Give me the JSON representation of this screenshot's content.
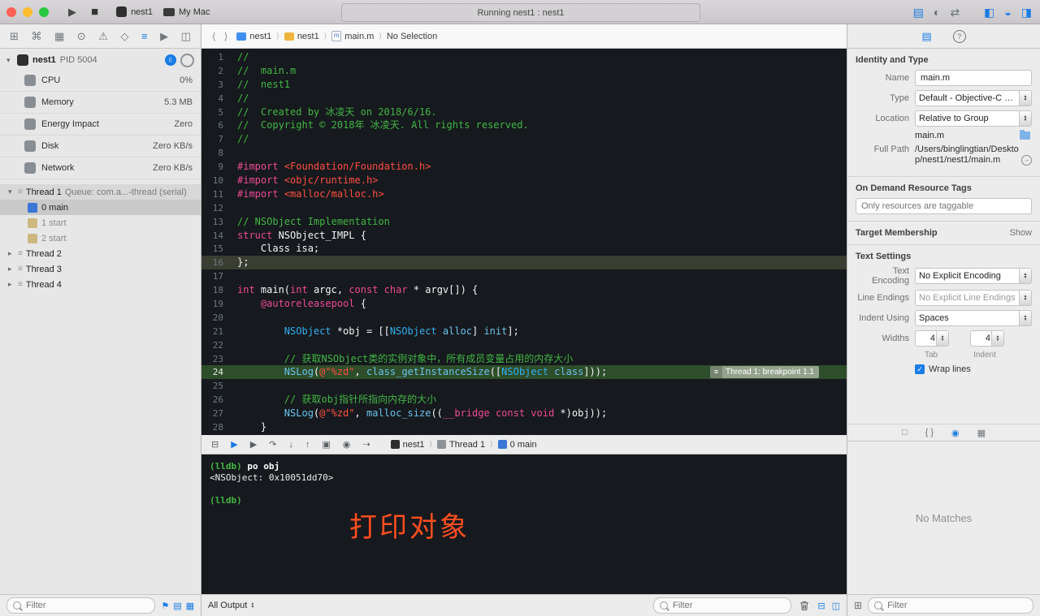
{
  "colors": {
    "accent": "#1a7ce5",
    "editor_background": "#16191d",
    "comment_green": "#41b645",
    "keyword_pink": "#ed4a96",
    "string_red": "#ff4f43",
    "type_blue": "#30b0f4",
    "function_blue": "#69c3f0",
    "exec_line_green": "#2e4d2a",
    "breakpoint_badge_green": "#93a28c",
    "annotation_orange": "#ff4e1f"
  },
  "window": {
    "run_glyph": "▶",
    "stop_glyph": "■",
    "scheme": "nest1",
    "destination": "My Mac",
    "status": "Running nest1 : nest1",
    "editor_mode_icons": [
      {
        "name": "standard-editor-icon",
        "glyph": "▤",
        "active": true
      },
      {
        "name": "assistant-editor-icon",
        "glyph": "◐",
        "active": false
      },
      {
        "name": "version-editor-icon",
        "glyph": "⇄",
        "active": false
      }
    ],
    "panel_toggle_icons": [
      {
        "name": "navigator-panel-icon",
        "glyph": "◧"
      },
      {
        "name": "debug-area-icon",
        "glyph": "◒"
      },
      {
        "name": "inspector-panel-icon",
        "glyph": "◨"
      }
    ]
  },
  "navigator_bar": {
    "icons": [
      {
        "name": "project-navigator-icon",
        "glyph": "⊞",
        "active": false
      },
      {
        "name": "source-control-navigator-icon",
        "glyph": "⌘",
        "active": false
      },
      {
        "name": "symbol-navigator-icon",
        "glyph": "▦",
        "active": false
      },
      {
        "name": "find-navigator-icon",
        "glyph": "⊙",
        "active": false
      },
      {
        "name": "issue-navigator-icon",
        "glyph": "⚠",
        "active": false
      },
      {
        "name": "test-navigator-icon",
        "glyph": "◇",
        "active": false
      },
      {
        "name": "debug-navigator-icon",
        "glyph": "≡",
        "active": true
      },
      {
        "name": "breakpoint-navigator-icon",
        "glyph": "▶",
        "active": false
      },
      {
        "name": "report-navigator-icon",
        "glyph": "◫",
        "active": false
      }
    ]
  },
  "jump_bar": {
    "items": [
      "nest1",
      "nest1",
      "main.m",
      "No Selection"
    ]
  },
  "debug_navigator": {
    "process": {
      "name": "nest1",
      "pid": "PID 5004"
    },
    "gauges": [
      {
        "label": "CPU",
        "value": "0%",
        "icon": "cpu-gauge-icon"
      },
      {
        "label": "Memory",
        "value": "5.3 MB",
        "icon": "memory-gauge-icon"
      },
      {
        "label": "Energy Impact",
        "value": "Zero",
        "icon": "energy-gauge-icon"
      },
      {
        "label": "Disk",
        "value": "Zero KB/s",
        "icon": "disk-gauge-icon"
      },
      {
        "label": "Network",
        "value": "Zero KB/s",
        "icon": "network-gauge-icon"
      }
    ],
    "threads": [
      {
        "label": "Thread 1",
        "queue": "Queue: com.a...-thread (serial)",
        "expanded": true,
        "selected": true,
        "frames": [
          {
            "label": "0 main",
            "color": "#3b76d8",
            "selected": true
          },
          {
            "label": "1 start",
            "color": "#cdb87f",
            "dim": true
          },
          {
            "label": "2 start",
            "color": "#cdb87f",
            "dim": true
          }
        ]
      },
      {
        "label": "Thread 2",
        "expanded": false,
        "frames": []
      },
      {
        "label": "Thread 3",
        "expanded": false,
        "frames": []
      },
      {
        "label": "Thread 4",
        "expanded": false,
        "frames": []
      }
    ]
  },
  "editor": {
    "lines": [
      {
        "n": 1,
        "seg": [
          [
            "c",
            "//"
          ]
        ]
      },
      {
        "n": 2,
        "seg": [
          [
            "c",
            "//  main.m"
          ]
        ]
      },
      {
        "n": 3,
        "seg": [
          [
            "c",
            "//  nest1"
          ]
        ]
      },
      {
        "n": 4,
        "seg": [
          [
            "c",
            "//"
          ]
        ]
      },
      {
        "n": 5,
        "seg": [
          [
            "c",
            "//  Created by 冰凌天 on 2018/6/16."
          ]
        ]
      },
      {
        "n": 6,
        "seg": [
          [
            "c",
            "//  Copyright © 2018年 冰凌天. All rights reserved."
          ]
        ]
      },
      {
        "n": 7,
        "seg": [
          [
            "c",
            "//"
          ]
        ]
      },
      {
        "n": 8,
        "seg": []
      },
      {
        "n": 9,
        "seg": [
          [
            "k",
            "#import"
          ],
          [
            "w",
            " "
          ],
          [
            "s",
            "<Foundation/Foundation.h>"
          ]
        ]
      },
      {
        "n": 10,
        "seg": [
          [
            "k",
            "#import"
          ],
          [
            "w",
            " "
          ],
          [
            "s",
            "<objc/runtime.h>"
          ]
        ]
      },
      {
        "n": 11,
        "seg": [
          [
            "k",
            "#import"
          ],
          [
            "w",
            " "
          ],
          [
            "s",
            "<malloc/malloc.h>"
          ]
        ]
      },
      {
        "n": 12,
        "seg": []
      },
      {
        "n": 13,
        "seg": [
          [
            "c",
            "// NSObject Implementation"
          ]
        ]
      },
      {
        "n": 14,
        "seg": [
          [
            "k",
            "struct"
          ],
          [
            "w",
            " NSObject_IMPL {"
          ]
        ]
      },
      {
        "n": 15,
        "seg": [
          [
            "w",
            "    Class isa;"
          ]
        ]
      },
      {
        "n": 16,
        "hl": "sel",
        "seg": [
          [
            "w",
            "};"
          ]
        ]
      },
      {
        "n": 17,
        "seg": []
      },
      {
        "n": 18,
        "seg": [
          [
            "k",
            "int"
          ],
          [
            "w",
            " main("
          ],
          [
            "k",
            "int"
          ],
          [
            "w",
            " argc, "
          ],
          [
            "k",
            "const"
          ],
          [
            "w",
            " "
          ],
          [
            "k",
            "char"
          ],
          [
            "w",
            " * argv[]) {"
          ]
        ]
      },
      {
        "n": 19,
        "seg": [
          [
            "w",
            "    "
          ],
          [
            "k",
            "@autoreleasepool"
          ],
          [
            "w",
            " {"
          ]
        ]
      },
      {
        "n": 20,
        "seg": []
      },
      {
        "n": 21,
        "seg": [
          [
            "w",
            "        "
          ],
          [
            "t",
            "NSObject"
          ],
          [
            "w",
            " *obj = [["
          ],
          [
            "t",
            "NSObject"
          ],
          [
            "w",
            " "
          ],
          [
            "f",
            "alloc"
          ],
          [
            "w",
            "] "
          ],
          [
            "f",
            "init"
          ],
          [
            "w",
            "];"
          ]
        ]
      },
      {
        "n": 22,
        "seg": []
      },
      {
        "n": 23,
        "seg": [
          [
            "w",
            "        "
          ],
          [
            "c",
            "// 获取NSObject类的实例对象中，所有成员变量占用的内存大小"
          ]
        ]
      },
      {
        "n": 24,
        "hl": "exec",
        "badge": "Thread 1: breakpoint 1.1",
        "seg": [
          [
            "w",
            "        "
          ],
          [
            "f",
            "NSLog"
          ],
          [
            "w",
            "("
          ],
          [
            "s",
            "@\"%zd\""
          ],
          [
            "w",
            ", "
          ],
          [
            "f",
            "class_getInstanceSize"
          ],
          [
            "w",
            "(["
          ],
          [
            "t",
            "NSObject"
          ],
          [
            "w",
            " "
          ],
          [
            "f",
            "class"
          ],
          [
            "w",
            "]));"
          ]
        ]
      },
      {
        "n": 25,
        "seg": []
      },
      {
        "n": 26,
        "seg": [
          [
            "w",
            "        "
          ],
          [
            "c",
            "// 获取obj指针所指向内存的大小"
          ]
        ]
      },
      {
        "n": 27,
        "seg": [
          [
            "w",
            "        "
          ],
          [
            "f",
            "NSLog"
          ],
          [
            "w",
            "("
          ],
          [
            "s",
            "@\"%zd\""
          ],
          [
            "w",
            ", "
          ],
          [
            "f",
            "malloc_size"
          ],
          [
            "w",
            "(("
          ],
          [
            "k",
            "__bridge"
          ],
          [
            "w",
            " "
          ],
          [
            "k",
            "const"
          ],
          [
            "w",
            " "
          ],
          [
            "k",
            "void"
          ],
          [
            "w",
            " *)obj));"
          ]
        ]
      },
      {
        "n": 28,
        "seg": [
          [
            "w",
            "    }"
          ]
        ]
      }
    ]
  },
  "debug_bar": {
    "icons": [
      {
        "name": "hide-debug-area-icon",
        "glyph": "⊟"
      },
      {
        "name": "breakpoints-toggle-icon",
        "glyph": "▶",
        "accent": true
      },
      {
        "name": "continue-icon",
        "glyph": "▶"
      },
      {
        "name": "step-over-icon",
        "glyph": "↷"
      },
      {
        "name": "step-into-icon",
        "glyph": "↓"
      },
      {
        "name": "step-out-icon",
        "glyph": "↑"
      },
      {
        "name": "view-hierarchy-icon",
        "glyph": "▣"
      },
      {
        "name": "memory-graph-icon",
        "glyph": "◉"
      },
      {
        "name": "simulate-location-icon",
        "glyph": "⇢"
      }
    ],
    "breadcrumb": [
      {
        "label": "nest1",
        "icon": "app-icon",
        "color": "#2f2f2f"
      },
      {
        "label": "Thread 1",
        "icon": "thread-icon",
        "color": "#8e9398"
      },
      {
        "label": "0 main",
        "icon": "stack-frame-icon",
        "color": "#3b76d8"
      }
    ]
  },
  "console": {
    "lines": [
      [
        [
          "g",
          "(lldb)"
        ],
        [
          "wb",
          " po obj"
        ]
      ],
      [
        [
          "w",
          "<NSObject: 0x10051dd70>"
        ]
      ],
      [],
      [
        [
          "g",
          "(lldb)"
        ]
      ]
    ],
    "annotation": "打印对象"
  },
  "console_bar": {
    "scope": "All Output",
    "filter_placeholder": "Filter",
    "pane_icons": [
      {
        "name": "dock-bottom-icon",
        "glyph": "⊟"
      },
      {
        "name": "console-split-icon",
        "glyph": "◫"
      }
    ]
  },
  "sidebar_filter": {
    "placeholder": "Filter",
    "icons": [
      {
        "name": "flag-filter-icon",
        "glyph": "⚑"
      },
      {
        "name": "frames-filter-icon",
        "glyph": "▤"
      },
      {
        "name": "threads-filter-icon",
        "glyph": "▦"
      }
    ]
  },
  "inspector": {
    "tabs": [
      {
        "name": "file-inspector-tab",
        "glyph": "▤",
        "active": true
      },
      {
        "name": "quick-help-inspector-tab",
        "glyph": "?",
        "help": true
      }
    ],
    "identity_header": "Identity and Type",
    "name_label": "Name",
    "name_value": "main.m",
    "type_label": "Type",
    "type_value": "Default - Objective-C Sou...",
    "location_label": "Location",
    "location_value": "Relative to Group",
    "location_file": "main.m",
    "fullpath_label": "Full Path",
    "fullpath_value": "/Users/binglingtian/Desktop/nest1/nest1/main.m",
    "odr_header": "On Demand Resource Tags",
    "odr_placeholder": "Only resources are taggable",
    "target_header": "Target Membership",
    "target_action": "Show",
    "text_settings_header": "Text Settings",
    "encoding_label": "Text Encoding",
    "encoding_value": "No Explicit Encoding",
    "line_endings_label": "Line Endings",
    "line_endings_value": "No Explicit Line Endings",
    "indent_label": "Indent Using",
    "indent_value": "Spaces",
    "widths_label": "Widths",
    "tab_width": "4",
    "tab_caption": "Tab",
    "indent_width": "4",
    "indent_caption": "Indent",
    "wrap_label": "Wrap lines"
  },
  "library": {
    "icons": [
      {
        "name": "file-template-library-icon",
        "glyph": "□"
      },
      {
        "name": "code-snippet-library-icon",
        "glyph": "{ }"
      },
      {
        "name": "object-library-icon",
        "glyph": "◉",
        "active": true
      },
      {
        "name": "media-library-icon",
        "glyph": "▦"
      }
    ],
    "grid_icon_glyph": "⊞",
    "empty": "No Matches",
    "filter_placeholder": "Filter"
  }
}
